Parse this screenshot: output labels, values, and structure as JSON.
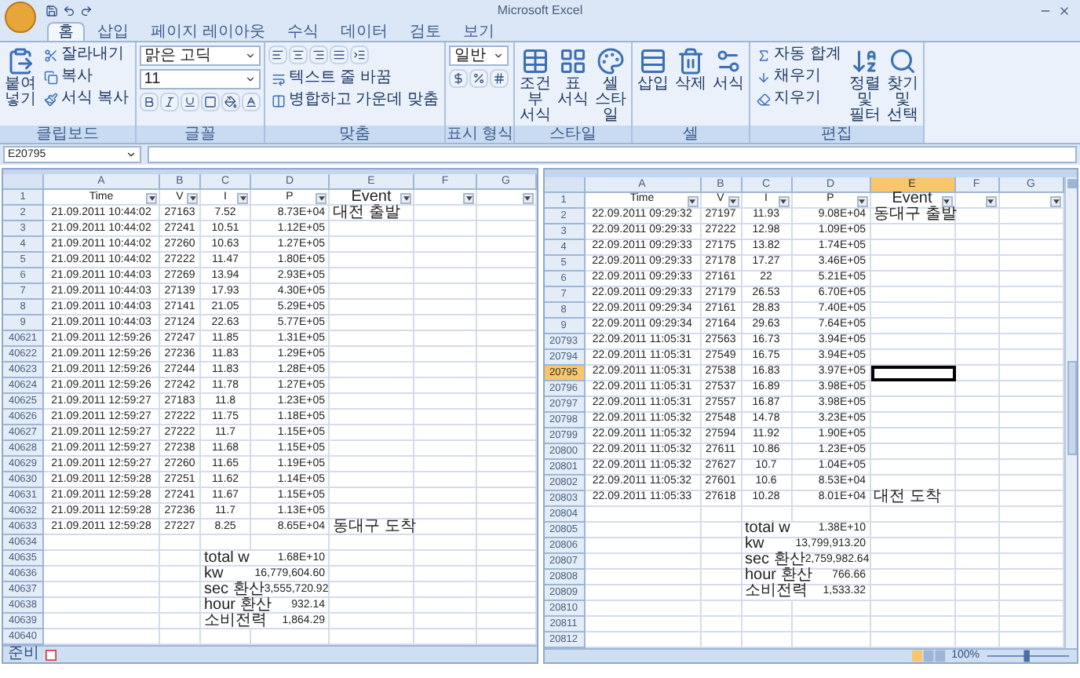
{
  "window": {
    "title": "Microsoft Excel"
  },
  "tabs": [
    {
      "label": "홈",
      "selected": true
    },
    {
      "label": "삽입",
      "selected": false
    },
    {
      "label": "페이지 레이아웃",
      "selected": false
    },
    {
      "label": "수식",
      "selected": false
    },
    {
      "label": "데이터",
      "selected": false
    },
    {
      "label": "검토",
      "selected": false
    },
    {
      "label": "보기",
      "selected": false
    }
  ],
  "ribbon": {
    "groups": [
      {
        "label": "클립보드",
        "items": [
          {
            "kind": "big",
            "label": "붙여넣기"
          },
          {
            "kind": "small",
            "label": "잘라내기"
          },
          {
            "kind": "small",
            "label": "복사"
          },
          {
            "kind": "small",
            "label": "서식 복사"
          }
        ]
      },
      {
        "label": "글꼴",
        "items": [
          {
            "kind": "field",
            "value": "맑은 고딕"
          },
          {
            "kind": "field",
            "value": "11"
          },
          {
            "kind": "tools"
          }
        ]
      },
      {
        "label": "맞춤",
        "items": [
          {
            "kind": "tools"
          },
          {
            "kind": "small",
            "label": "텍스트 줄 바꿈"
          },
          {
            "kind": "small",
            "label": "병합하고 가운데 맞춤"
          }
        ]
      },
      {
        "label": "표시 형식",
        "items": [
          {
            "kind": "field",
            "value": "일반"
          },
          {
            "kind": "tools"
          }
        ]
      },
      {
        "label": "스타일",
        "items": [
          {
            "kind": "big",
            "label": "조건부 서식"
          },
          {
            "kind": "big",
            "label": "표 서식"
          },
          {
            "kind": "big",
            "label": "셀 스타일"
          }
        ]
      },
      {
        "label": "셀",
        "items": [
          {
            "kind": "big",
            "label": "삽입"
          },
          {
            "kind": "big",
            "label": "삭제"
          },
          {
            "kind": "big",
            "label": "서식"
          }
        ]
      },
      {
        "label": "편집",
        "items": [
          {
            "kind": "small",
            "label": "자동 합계"
          },
          {
            "kind": "small",
            "label": "채우기"
          },
          {
            "kind": "small",
            "label": "지우기"
          },
          {
            "kind": "big",
            "label": "정렬 및 필터"
          },
          {
            "kind": "big",
            "label": "찾기 및 선택"
          }
        ]
      }
    ]
  },
  "formula_bar": {
    "name_box": "E20795"
  },
  "sheets": [
    {
      "columns": [
        {
          "label": "A",
          "selected": false
        },
        {
          "label": "B",
          "selected": false
        },
        {
          "label": "C",
          "selected": false
        },
        {
          "label": "D",
          "selected": false
        },
        {
          "label": "E",
          "selected": false
        },
        {
          "label": "F",
          "selected": false
        },
        {
          "label": "G",
          "selected": false
        }
      ],
      "rows": [
        {
          "num": "1",
          "kind": "header",
          "selected": false,
          "cells": {
            "a": "Time",
            "b": "V",
            "c": "I",
            "d": "P",
            "e": "Event"
          }
        },
        {
          "num": "2",
          "kind": "data",
          "selected": false,
          "cells": {
            "a": "21.09.2011 10:44:02",
            "b": "27163",
            "c": "7.52",
            "d": "8.73E+04",
            "e": "대전 출발"
          }
        },
        {
          "num": "3",
          "kind": "data",
          "selected": false,
          "cells": {
            "a": "21.09.2011 10:44:02",
            "b": "27241",
            "c": "10.51",
            "d": "1.12E+05"
          }
        },
        {
          "num": "4",
          "kind": "data",
          "selected": false,
          "cells": {
            "a": "21.09.2011 10:44:02",
            "b": "27260",
            "c": "10.63",
            "d": "1.27E+05"
          }
        },
        {
          "num": "5",
          "kind": "data",
          "selected": false,
          "cells": {
            "a": "21.09.2011 10:44:02",
            "b": "27222",
            "c": "11.47",
            "d": "1.80E+05"
          }
        },
        {
          "num": "6",
          "kind": "data",
          "selected": false,
          "cells": {
            "a": "21.09.2011 10:44:03",
            "b": "27269",
            "c": "13.94",
            "d": "2.93E+05"
          }
        },
        {
          "num": "7",
          "kind": "data",
          "selected": false,
          "cells": {
            "a": "21.09.2011 10:44:03",
            "b": "27139",
            "c": "17.93",
            "d": "4.30E+05"
          }
        },
        {
          "num": "8",
          "kind": "data",
          "selected": false,
          "cells": {
            "a": "21.09.2011 10:44:03",
            "b": "27141",
            "c": "21.05",
            "d": "5.29E+05"
          }
        },
        {
          "num": "9",
          "kind": "data",
          "selected": false,
          "cells": {
            "a": "21.09.2011 10:44:03",
            "b": "27124",
            "c": "22.63",
            "d": "5.77E+05"
          }
        },
        {
          "num": "40621",
          "kind": "data",
          "selected": false,
          "cells": {
            "a": "21.09.2011 12:59:26",
            "b": "27247",
            "c": "11.85",
            "d": "1.31E+05"
          }
        },
        {
          "num": "40622",
          "kind": "data",
          "selected": false,
          "cells": {
            "a": "21.09.2011 12:59:26",
            "b": "27236",
            "c": "11.83",
            "d": "1.29E+05"
          }
        },
        {
          "num": "40623",
          "kind": "data",
          "selected": false,
          "cells": {
            "a": "21.09.2011 12:59:26",
            "b": "27244",
            "c": "11.83",
            "d": "1.28E+05"
          }
        },
        {
          "num": "40624",
          "kind": "data",
          "selected": false,
          "cells": {
            "a": "21.09.2011 12:59:26",
            "b": "27242",
            "c": "11.78",
            "d": "1.27E+05"
          }
        },
        {
          "num": "40625",
          "kind": "data",
          "selected": false,
          "cells": {
            "a": "21.09.2011 12:59:27",
            "b": "27183",
            "c": "11.8",
            "d": "1.23E+05"
          }
        },
        {
          "num": "40626",
          "kind": "data",
          "selected": false,
          "cells": {
            "a": "21.09.2011 12:59:27",
            "b": "27222",
            "c": "11.75",
            "d": "1.18E+05"
          }
        },
        {
          "num": "40627",
          "kind": "data",
          "selected": false,
          "cells": {
            "a": "21.09.2011 12:59:27",
            "b": "27222",
            "c": "11.7",
            "d": "1.15E+05"
          }
        },
        {
          "num": "40628",
          "kind": "data",
          "selected": false,
          "cells": {
            "a": "21.09.2011 12:59:27",
            "b": "27238",
            "c": "11.68",
            "d": "1.15E+05"
          }
        },
        {
          "num": "40629",
          "kind": "data",
          "selected": false,
          "cells": {
            "a": "21.09.2011 12:59:27",
            "b": "27260",
            "c": "11.65",
            "d": "1.19E+05"
          }
        },
        {
          "num": "40630",
          "kind": "data",
          "selected": false,
          "cells": {
            "a": "21.09.2011 12:59:28",
            "b": "27251",
            "c": "11.62",
            "d": "1.14E+05"
          }
        },
        {
          "num": "40631",
          "kind": "data",
          "selected": false,
          "cells": {
            "a": "21.09.2011 12:59:28",
            "b": "27241",
            "c": "11.67",
            "d": "1.15E+05"
          }
        },
        {
          "num": "40632",
          "kind": "data",
          "selected": false,
          "cells": {
            "a": "21.09.2011 12:59:28",
            "b": "27236",
            "c": "11.7",
            "d": "1.13E+05"
          }
        },
        {
          "num": "40633",
          "kind": "data",
          "selected": false,
          "cells": {
            "a": "21.09.2011 12:59:28",
            "b": "27227",
            "c": "8.25",
            "d": "8.65E+04",
            "e": "동대구 도착"
          }
        },
        {
          "num": "40634",
          "kind": "blank",
          "selected": false
        },
        {
          "num": "40635",
          "kind": "total",
          "selected": false,
          "cells": {
            "c": "total w",
            "d": "1.68E+10"
          }
        },
        {
          "num": "40636",
          "kind": "total",
          "selected": false,
          "cells": {
            "c": "kw",
            "d": "16,779,604.60"
          }
        },
        {
          "num": "40637",
          "kind": "total",
          "selected": false,
          "cells": {
            "c": "sec 환산",
            "d": "3,555,720.92"
          }
        },
        {
          "num": "40638",
          "kind": "total",
          "selected": false,
          "cells": {
            "c": "hour 환산",
            "d": "932.14"
          }
        },
        {
          "num": "40639",
          "kind": "total",
          "selected": false,
          "cells": {
            "c": "소비전력",
            "d": "1,864.29"
          }
        },
        {
          "num": "40640",
          "kind": "blank",
          "selected": false
        }
      ],
      "status": "준비"
    },
    {
      "columns": [
        {
          "label": "A",
          "selected": false
        },
        {
          "label": "B",
          "selected": false
        },
        {
          "label": "C",
          "selected": false
        },
        {
          "label": "D",
          "selected": false
        },
        {
          "label": "E",
          "selected": true
        },
        {
          "label": "F",
          "selected": false
        },
        {
          "label": "G",
          "selected": false
        }
      ],
      "rows": [
        {
          "num": "1",
          "kind": "header",
          "selected": false,
          "cells": {
            "a": "Time",
            "b": "V",
            "c": "I",
            "d": "P",
            "e": "Event"
          }
        },
        {
          "num": "2",
          "kind": "data",
          "selected": false,
          "cells": {
            "a": "22.09.2011 09:29:32",
            "b": "27197",
            "c": "11.93",
            "d": "9.08E+04",
            "e": "동대구 출발"
          }
        },
        {
          "num": "3",
          "kind": "data",
          "selected": false,
          "cells": {
            "a": "22.09.2011 09:29:33",
            "b": "27222",
            "c": "12.98",
            "d": "1.09E+05"
          }
        },
        {
          "num": "4",
          "kind": "data",
          "selected": false,
          "cells": {
            "a": "22.09.2011 09:29:33",
            "b": "27175",
            "c": "13.82",
            "d": "1.74E+05"
          }
        },
        {
          "num": "5",
          "kind": "data",
          "selected": false,
          "cells": {
            "a": "22.09.2011 09:29:33",
            "b": "27178",
            "c": "17.27",
            "d": "3.46E+05"
          }
        },
        {
          "num": "6",
          "kind": "data",
          "selected": false,
          "cells": {
            "a": "22.09.2011 09:29:33",
            "b": "27161",
            "c": "22",
            "d": "5.21E+05"
          }
        },
        {
          "num": "7",
          "kind": "data",
          "selected": false,
          "cells": {
            "a": "22.09.2011 09:29:33",
            "b": "27179",
            "c": "26.53",
            "d": "6.70E+05"
          }
        },
        {
          "num": "8",
          "kind": "data",
          "selected": false,
          "cells": {
            "a": "22.09.2011 09:29:34",
            "b": "27161",
            "c": "28.83",
            "d": "7.40E+05"
          }
        },
        {
          "num": "9",
          "kind": "data",
          "selected": false,
          "cells": {
            "a": "22.09.2011 09:29:34",
            "b": "27164",
            "c": "29.63",
            "d": "7.64E+05"
          }
        },
        {
          "num": "20793",
          "kind": "data",
          "selected": false,
          "cells": {
            "a": "22.09.2011 11:05:31",
            "b": "27563",
            "c": "16.73",
            "d": "3.94E+05"
          }
        },
        {
          "num": "20794",
          "kind": "data",
          "selected": false,
          "cells": {
            "a": "22.09.2011 11:05:31",
            "b": "27549",
            "c": "16.75",
            "d": "3.94E+05"
          }
        },
        {
          "num": "20795",
          "kind": "data",
          "selected": true,
          "cells": {
            "a": "22.09.2011 11:05:31",
            "b": "27538",
            "c": "16.83",
            "d": "3.97E+05"
          }
        },
        {
          "num": "20796",
          "kind": "data",
          "selected": false,
          "cells": {
            "a": "22.09.2011 11:05:31",
            "b": "27537",
            "c": "16.89",
            "d": "3.98E+05"
          }
        },
        {
          "num": "20797",
          "kind": "data",
          "selected": false,
          "cells": {
            "a": "22.09.2011 11:05:31",
            "b": "27557",
            "c": "16.87",
            "d": "3.98E+05"
          }
        },
        {
          "num": "20798",
          "kind": "data",
          "selected": false,
          "cells": {
            "a": "22.09.2011 11:05:32",
            "b": "27548",
            "c": "14.78",
            "d": "3.23E+05"
          }
        },
        {
          "num": "20799",
          "kind": "data",
          "selected": false,
          "cells": {
            "a": "22.09.2011 11:05:32",
            "b": "27594",
            "c": "11.92",
            "d": "1.90E+05"
          }
        },
        {
          "num": "20800",
          "kind": "data",
          "selected": false,
          "cells": {
            "a": "22.09.2011 11:05:32",
            "b": "27611",
            "c": "10.86",
            "d": "1.23E+05"
          }
        },
        {
          "num": "20801",
          "kind": "data",
          "selected": false,
          "cells": {
            "a": "22.09.2011 11:05:32",
            "b": "27627",
            "c": "10.7",
            "d": "1.04E+05"
          }
        },
        {
          "num": "20802",
          "kind": "data",
          "selected": false,
          "cells": {
            "a": "22.09.2011 11:05:32",
            "b": "27601",
            "c": "10.6",
            "d": "8.53E+04"
          }
        },
        {
          "num": "20803",
          "kind": "data",
          "selected": false,
          "cells": {
            "a": "22.09.2011 11:05:33",
            "b": "27618",
            "c": "10.28",
            "d": "8.01E+04",
            "e": "대전 도착"
          }
        },
        {
          "num": "20804",
          "kind": "blank",
          "selected": false
        },
        {
          "num": "20805",
          "kind": "total",
          "selected": false,
          "cells": {
            "c": "total w",
            "d": "1.38E+10"
          }
        },
        {
          "num": "20806",
          "kind": "total",
          "selected": false,
          "cells": {
            "c": "kw",
            "d": "13,799,913.20"
          }
        },
        {
          "num": "20807",
          "kind": "total",
          "selected": false,
          "cells": {
            "c": "sec 환산",
            "d": "2,759,982.64"
          }
        },
        {
          "num": "20808",
          "kind": "total",
          "selected": false,
          "cells": {
            "c": "hour 환산",
            "d": "766.66"
          }
        },
        {
          "num": "20809",
          "kind": "total",
          "selected": false,
          "cells": {
            "c": "소비전력",
            "d": "1,533.32"
          }
        },
        {
          "num": "20810",
          "kind": "blank",
          "selected": false
        },
        {
          "num": "20811",
          "kind": "blank",
          "selected": false
        },
        {
          "num": "20812",
          "kind": "blank",
          "selected": false
        }
      ],
      "zoom": "100%"
    }
  ]
}
